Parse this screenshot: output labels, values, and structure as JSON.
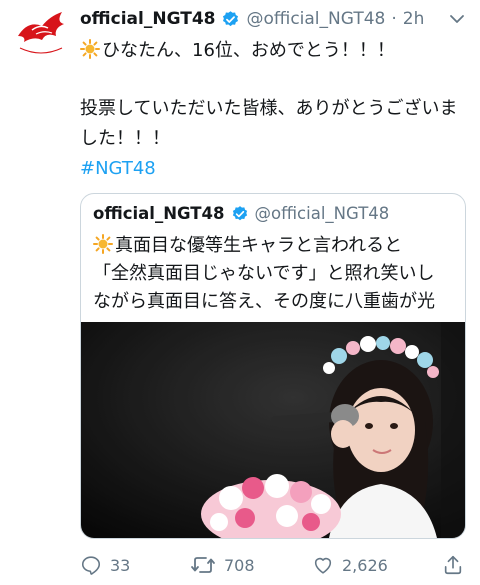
{
  "tweet": {
    "author_name": "official_NGT48",
    "handle": "@official_NGT48",
    "separator": "·",
    "time": "2h",
    "avatar_logo_text": "NGT48",
    "line1": "ひなたん、16位、おめでとう！！！",
    "line2a": "投票していただいた皆様、ありがとうございま",
    "line2b": "した！！！",
    "line2_full": "投票していただいた皆様、ありがとうございました！！！",
    "hashtag": "#NGT48"
  },
  "quoted": {
    "author_name": "official_NGT48",
    "handle": "@official_NGT48",
    "line1": "真面目な優等生キャラと言われると",
    "line2": "「全然真面目じゃないです」と照れ笑いし",
    "line3": "ながら真面目に答え、その度に八重歯が光"
  },
  "actions": {
    "replies": "33",
    "retweets": "708",
    "likes": "2,626"
  },
  "colors": {
    "accent": "#1da1f2",
    "muted": "#657786",
    "border": "#ccd6dd",
    "logo_red": "#d7141a"
  }
}
